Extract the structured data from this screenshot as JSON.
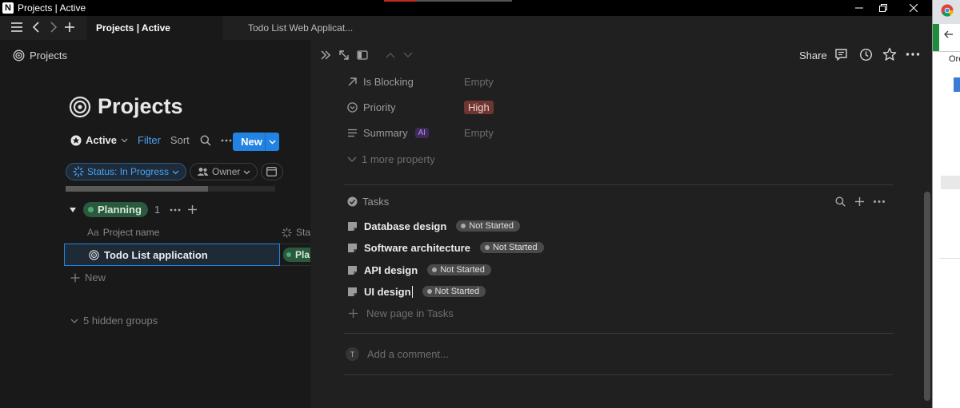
{
  "window": {
    "app_icon": "N",
    "title": "Projects | Active"
  },
  "tabs": [
    {
      "label": "Projects | Active",
      "active": true
    },
    {
      "label": "Todo List Web Applicat...",
      "active": false
    }
  ],
  "left": {
    "breadcrumb": "Projects",
    "page_title": "Projects",
    "view_name": "Active",
    "filter_label": "Filter",
    "sort_label": "Sort",
    "new_label": "New",
    "chips": {
      "status": "Status: In Progress",
      "owner": "Owner"
    },
    "progress_fraction": 0.68,
    "group": {
      "name": "Planning",
      "count": "1"
    },
    "columns": {
      "name_prefix": "Aa",
      "name": "Project name",
      "status": "Sta"
    },
    "row": {
      "name": "Todo List application",
      "status": "Pla"
    },
    "new_row_label": "New",
    "hidden_groups": "5 hidden groups"
  },
  "right": {
    "share_label": "Share",
    "properties": [
      {
        "name": "Is Blocking",
        "icon": "arrow-up-right-icon",
        "value": "Empty"
      },
      {
        "name": "Priority",
        "icon": "chevron-circle-icon",
        "value": "High"
      },
      {
        "name": "Summary",
        "icon": "text-lines-icon",
        "badge": "AI",
        "value": "Empty"
      }
    ],
    "more_property": "1 more property",
    "tasks_title": "Tasks",
    "tasks": [
      {
        "name": "Database design",
        "status": "Not Started"
      },
      {
        "name": "Software architecture",
        "status": "Not Started"
      },
      {
        "name": "API design",
        "status": "Not Started"
      },
      {
        "name": "UI design",
        "status": "Not Started"
      }
    ],
    "new_page_label": "New page in Tasks",
    "comment_avatar": "T",
    "comment_placeholder": "Add a comment..."
  },
  "side_window": {
    "text_fragment": "Ore"
  },
  "colors": {
    "accent_blue": "#2383e2",
    "priority_high": "#6e3630",
    "group_green": "#2b593f"
  }
}
